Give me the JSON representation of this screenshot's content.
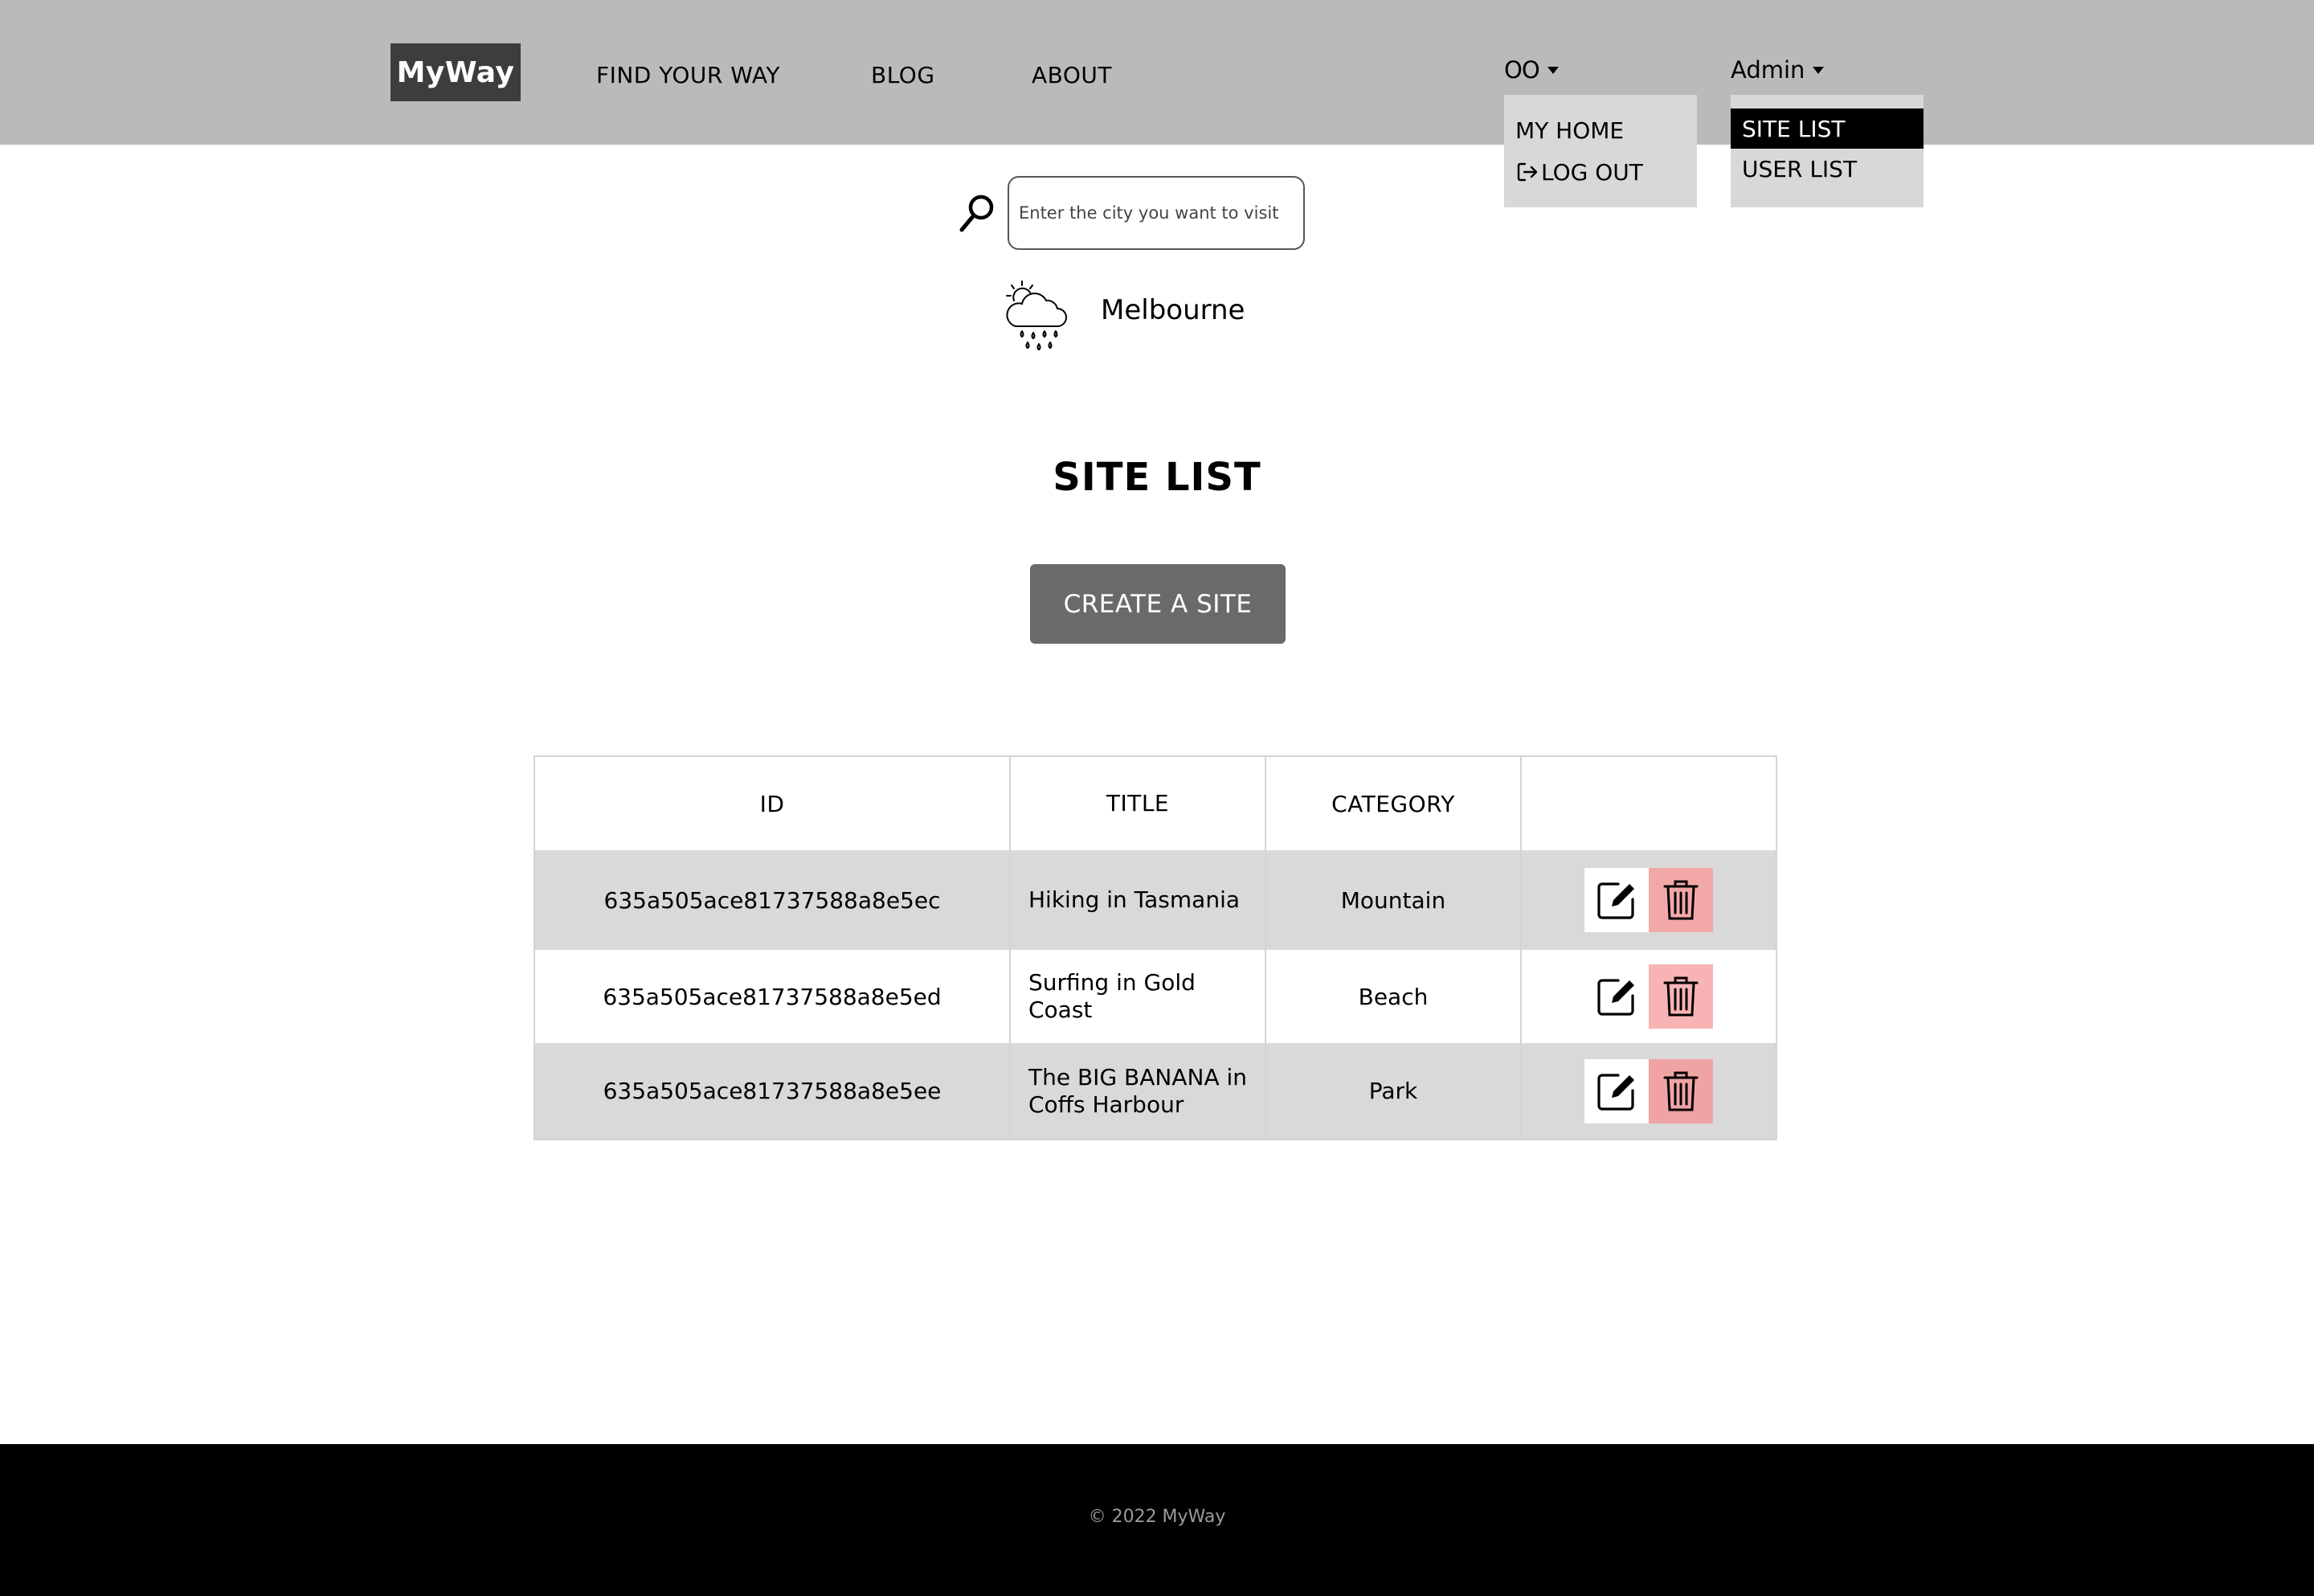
{
  "header": {
    "logo": "MyWay",
    "nav": {
      "find": "FIND YOUR WAY",
      "blog": "BLOG",
      "about": "ABOUT"
    },
    "user_menu": {
      "initials": "OO",
      "items": [
        "MY HOME",
        "LOG OUT"
      ]
    },
    "admin_menu": {
      "label": "Admin",
      "items": [
        "SITE LIST",
        "USER LIST"
      ],
      "active": "SITE LIST"
    }
  },
  "search": {
    "placeholder": "Enter the city you want to visit",
    "icon": "search-icon"
  },
  "weather": {
    "icon": "cloud-rain-sun-icon",
    "city": "Melbourne"
  },
  "page": {
    "title": "SITE LIST",
    "create_button": "CREATE A SITE"
  },
  "table": {
    "columns": [
      "ID",
      "TITLE",
      "CATEGORY",
      ""
    ],
    "rows": [
      {
        "id": "635a505ace81737588a8e5ec",
        "title": "Hiking in Tasmania",
        "category": "Mountain"
      },
      {
        "id": "635a505ace81737588a8e5ed",
        "title": "Surfing in Gold Coast",
        "category": "Beach"
      },
      {
        "id": "635a505ace81737588a8e5ee",
        "title": "The BIG BANANA in Coffs Harbour",
        "category": "Park"
      }
    ],
    "row_colors": [
      "#d9d9d9",
      "#ffffff",
      "#d9d9d9"
    ],
    "delete_colors": [
      "#f3a8a8",
      "#f8b4b4",
      "#f0a3a3"
    ]
  },
  "footer": {
    "copyright": "© 2022 MyWay"
  },
  "colors": {
    "header_bg": "#bababa",
    "logo_bg": "#3d3d3d",
    "button_bg": "#6a6a6a",
    "dropdown_bg": "#d8d8d8",
    "footer_bg": "#000000"
  }
}
